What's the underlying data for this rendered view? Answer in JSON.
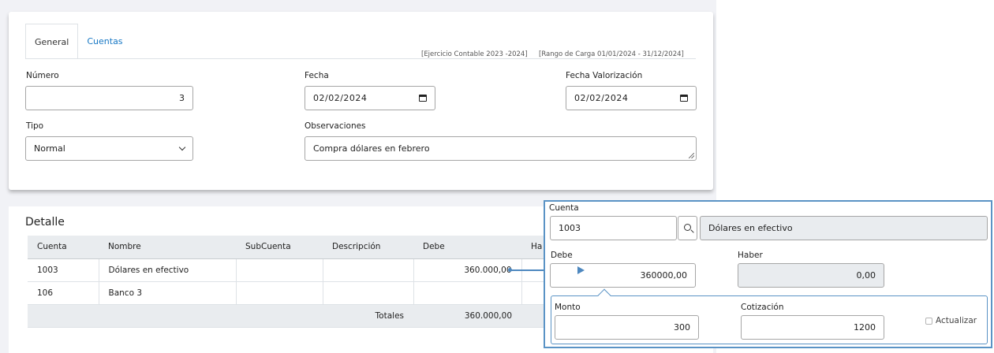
{
  "tabs": [
    {
      "label": "General",
      "active": true
    },
    {
      "label": "Cuentas",
      "active": false
    }
  ],
  "meta": {
    "ejercicio": "[Ejercicio Contable 2023 -2024]",
    "rango": "[Rango de Carga  01/01/2024  -  31/12/2024]"
  },
  "form": {
    "numero": {
      "label": "Número",
      "value": "3"
    },
    "fecha": {
      "label": "Fecha",
      "value": "02/02/2024"
    },
    "fecha_valorizacion": {
      "label": "Fecha Valorización",
      "value": "02/02/2024"
    },
    "tipo": {
      "label": "Tipo",
      "value": "Normal"
    },
    "observaciones": {
      "label": "Observaciones",
      "value": "Compra dólares en febrero"
    }
  },
  "detalle": {
    "title": "Detalle",
    "columns": [
      "Cuenta",
      "Nombre",
      "SubCuenta",
      "Descripción",
      "Debe",
      "Ha"
    ],
    "rows": [
      [
        "1003",
        "Dólares en efectivo",
        "",
        "",
        "360.000,00",
        ""
      ],
      [
        "106",
        "Banco 3",
        "",
        "",
        "",
        ""
      ]
    ],
    "totals_label": "Totales",
    "totals_debe": "360.000,00"
  },
  "popup": {
    "cuenta_label": "Cuenta",
    "cuenta_value": "1003",
    "cuenta_nombre": "Dólares en efectivo",
    "debe_label": "Debe",
    "debe_value": "360000,00",
    "haber_label": "Haber",
    "haber_value": "0,00",
    "monto_label": "Monto",
    "monto_value": "300",
    "cotizacion_label": "Cotización",
    "cotizacion_value": "1200",
    "actualizar_label": "Actualizar"
  },
  "colors": {
    "accent": "#5a93c5",
    "link": "#1677c4",
    "header_bg": "#e9ecef"
  },
  "icons": {
    "calendar": "calendar-icon",
    "chevron": "chevron-down-icon",
    "search": "search-icon"
  }
}
